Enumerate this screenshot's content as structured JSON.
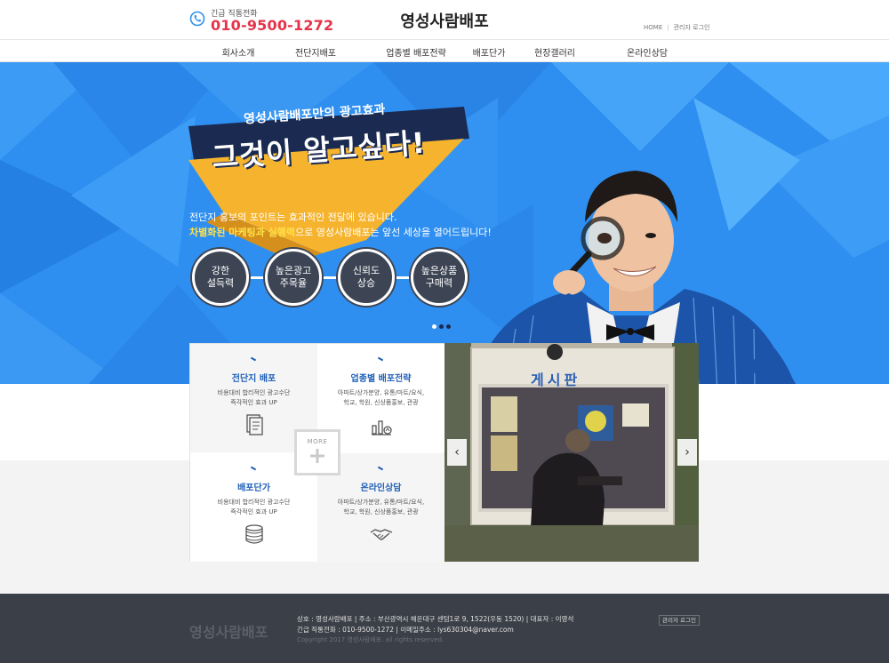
{
  "header": {
    "phone_label": "긴급 직통전화",
    "phone_number": "010-9500-1272",
    "logo": "영성사람배포",
    "util_home": "HOME",
    "util_sep": "|",
    "util_admin": "관리자 로그인"
  },
  "nav": {
    "items": [
      "회사소개",
      "전단지배포",
      "업종별 배포전략",
      "배포단가",
      "현장갤러리",
      "온라인상담"
    ]
  },
  "hero": {
    "banner_top": "영성사람배포만의 광고효과",
    "banner_main": "그것이 알고싶다!",
    "text1": "전단지 홍보의 포인트는 효과적인 전달에 있습니다.",
    "text2_highlight": "차별화된 마케팅과 실행력",
    "text2_rest": "으로 영성사람배포는 앞선 세상을 열어드립니다!",
    "pills": [
      {
        "line1": "강한",
        "line2": "설득력"
      },
      {
        "line1": "높은광고",
        "line2": "주목율"
      },
      {
        "line1": "신뢰도",
        "line2": "상승"
      },
      {
        "line1": "높은상품",
        "line2": "구매력"
      }
    ],
    "slide_count": 3,
    "active_slide": 0
  },
  "cards": [
    {
      "title": "전단지 배포",
      "desc": "비용대비 합리적인 광고수단\n즉각적인 효과 UP",
      "icon": "document-icon"
    },
    {
      "title": "업종별 배포전략",
      "desc": "아파트/상가분양, 유통/마트/요식,\n학교, 학원, 신상품홍보, 관광",
      "icon": "chart-icon"
    },
    {
      "title": "배포단가",
      "desc": "비용대비 합리적인 광고수단\n즉각적인 효과 UP",
      "icon": "coins-icon"
    },
    {
      "title": "온라인상담",
      "desc": "아파트/상가분양, 유통/마트/요식,\n학교, 학원, 신상품홍보, 관광",
      "icon": "handshake-icon"
    }
  ],
  "more": {
    "label": "MORE"
  },
  "photo": {
    "sign_text": "게시판",
    "prev": "‹",
    "next": "›"
  },
  "footer": {
    "logo": "영성사람배포",
    "line1": "상호 : 영성사람배포  |  주소 : 부산광역시 해운대구 센텀1로 9, 1522(우동 1520)  |  대표자 : 이영석",
    "line2": "긴급 직통전화 : 010-9500-1272  |  이메일주소 : lys630304@naver.com",
    "copyright": "Copyright 2017 영성사람배포. all rights reserved.",
    "admin_button": "관리자 로그인"
  },
  "colors": {
    "accent_red": "#e6334a",
    "hero_blue": "#2f8ff0",
    "card_title_blue": "#1f5fb8",
    "footer_bg": "#3b3f47",
    "banner_yellow": "#f6b42e",
    "banner_navy": "#1a2a50"
  }
}
